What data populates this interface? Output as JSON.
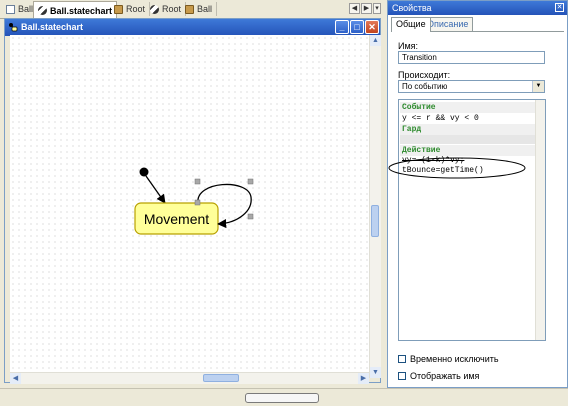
{
  "tabs": [
    {
      "label": "Ball",
      "icon": "document-icon"
    },
    {
      "label": "Ball.statechart",
      "icon": "statechart-icon",
      "active": true
    },
    {
      "label": "Root",
      "icon": "root-class-icon"
    },
    {
      "label": "Root",
      "icon": "statechart-icon"
    },
    {
      "label": "Ball",
      "icon": "root-class-icon"
    }
  ],
  "editor": {
    "title": "Ball.statechart",
    "minimize": "_",
    "maximize": "□",
    "close": "✕"
  },
  "diagram": {
    "state_label": "Movement",
    "state_fill": "#ffff99",
    "state_border": "#b8a000"
  },
  "properties": {
    "title": "Свойства",
    "close": "✕",
    "tabs": [
      "Общие",
      "Описание"
    ],
    "name_label": "Имя:",
    "name_value": "Transition",
    "trigger_label": "Происходит:",
    "trigger_value": "По событию",
    "code": {
      "event_header": "Событие",
      "event_expr": "y <= r && vy < 0",
      "guard_header": "Гард",
      "action_header": "Действие",
      "action_line1": "vy=-(1-k)*vy;",
      "action_line2": "tBounce=getTime()"
    },
    "exclude_label": "Временно исключить",
    "show_name_label": "Отображать имя"
  }
}
